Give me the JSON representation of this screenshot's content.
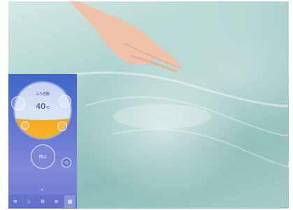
{
  "app": {
    "mode": "ふろ自動",
    "sub_status": "",
    "temperature": "40",
    "temperature_unit": "℃",
    "left_label": "",
    "right_label": "",
    "stop_label": "停止",
    "nav": [
      {
        "icon": "wifi-icon",
        "label": ""
      },
      {
        "icon": "bath-icon",
        "label": ""
      },
      {
        "icon": "gear-icon",
        "label": ""
      },
      {
        "icon": "menu-icon",
        "label": ""
      },
      {
        "icon": "remote-icon",
        "label": ""
      }
    ]
  },
  "colors": {
    "panel_top": "#3f68c9",
    "panel_bottom": "#6c78d1",
    "water_level": "#f2a41d"
  }
}
